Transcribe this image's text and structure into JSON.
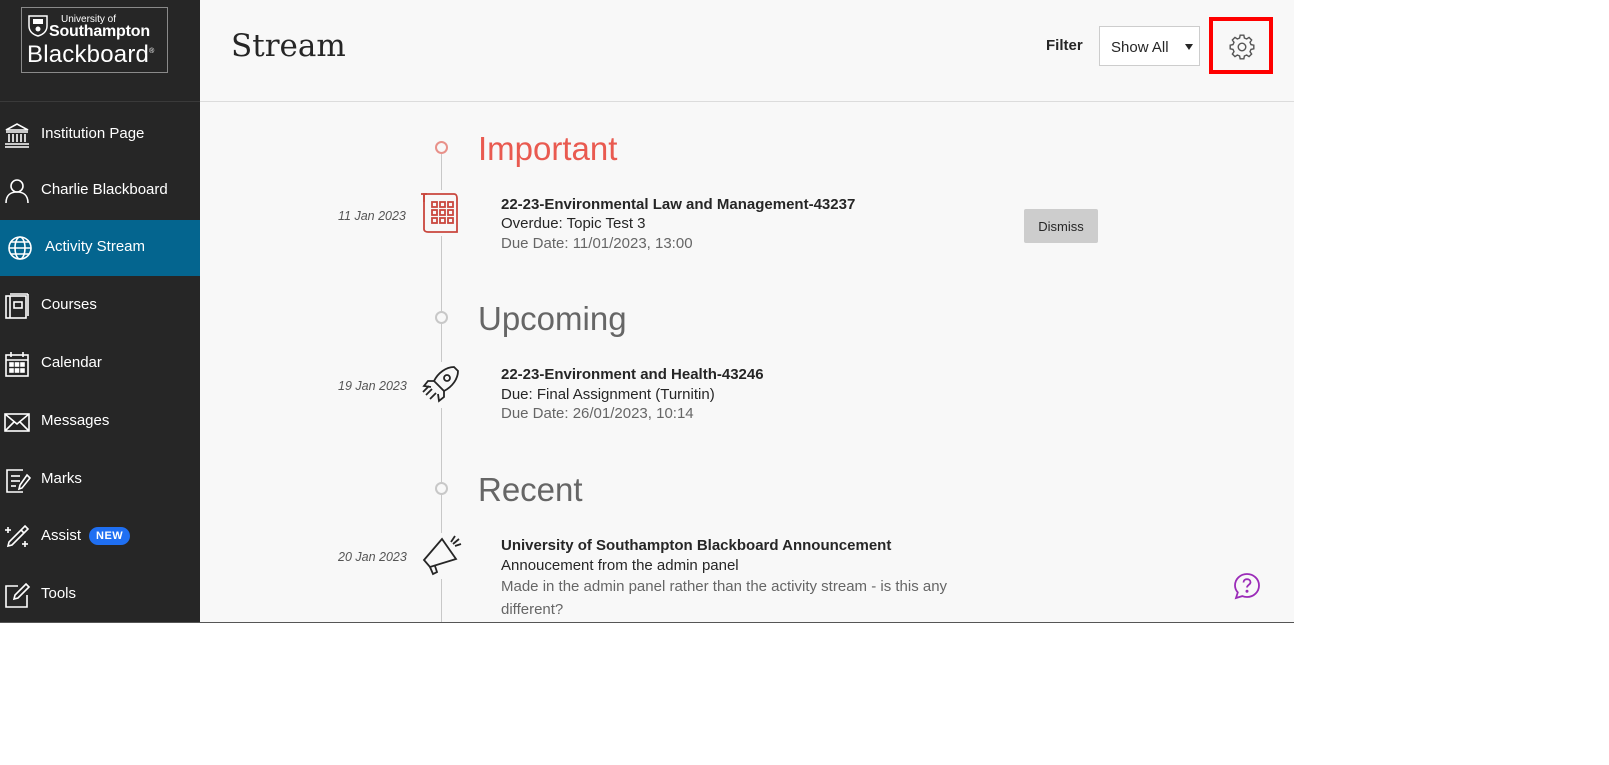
{
  "logo": {
    "line1": "University of",
    "line2": "Southampton",
    "line3": "Blackboard",
    "reg": "®"
  },
  "sidebar": {
    "items": [
      {
        "label": "Institution Page",
        "icon": "institution-icon"
      },
      {
        "label": "Charlie Blackboard",
        "icon": "user-icon"
      },
      {
        "label": "Activity Stream",
        "icon": "globe-icon",
        "active": true
      },
      {
        "label": "Courses",
        "icon": "courses-icon"
      },
      {
        "label": "Calendar",
        "icon": "calendar-icon"
      },
      {
        "label": "Messages",
        "icon": "envelope-icon"
      },
      {
        "label": "Marks",
        "icon": "marks-icon"
      },
      {
        "label": "Assist",
        "icon": "assist-icon",
        "badge": "NEW"
      },
      {
        "label": "Tools",
        "icon": "tools-icon"
      }
    ]
  },
  "header": {
    "title": "Stream",
    "filter_label": "Filter",
    "filter_value": "Show All",
    "settings_icon": "gear-icon"
  },
  "stream": {
    "important": {
      "title": "Important",
      "item": {
        "date": "11 Jan 2023",
        "icon": "assignment-grid-icon",
        "title": "22-23-Environmental Law and Management-43237",
        "line2": "Overdue: Topic Test 3",
        "line3": "Due Date: 11/01/2023, 13:00",
        "action": "Dismiss"
      }
    },
    "upcoming": {
      "title": "Upcoming",
      "item": {
        "date": "19 Jan 2023",
        "icon": "rocket-icon",
        "title": "22-23-Environment and Health-43246",
        "line2": "Due: Final Assignment (Turnitin)",
        "line3": "Due Date: 26/01/2023, 10:14"
      }
    },
    "recent": {
      "title": "Recent",
      "item": {
        "date": "20 Jan 2023",
        "icon": "megaphone-icon",
        "title": "University of Southampton Blackboard Announcement",
        "line2": "Annoucement from the admin panel",
        "line3": "Made in the admin panel rather than the activity stream - is this any different?"
      }
    }
  },
  "colors": {
    "sidebar_bg": "#262626",
    "active_bg": "#04658f",
    "important": "#e95a50",
    "badge": "#1f6ff2",
    "highlight_box": "#ff0000",
    "help": "#9b2bb8"
  }
}
